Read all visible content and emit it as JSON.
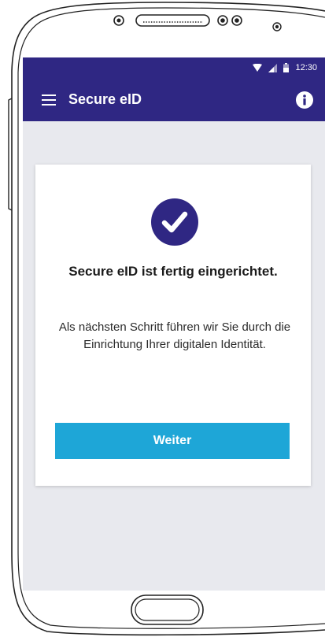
{
  "status_bar": {
    "time": "12:30",
    "icons": [
      "wifi-icon",
      "signal-icon",
      "battery-icon"
    ]
  },
  "app_bar": {
    "title": "Secure eID",
    "menu_icon": "menu-icon",
    "info_icon": "info-icon"
  },
  "card": {
    "icon": "check-circle-icon",
    "title": "Secure eID ist fertig eingerichtet.",
    "body": "Als nächsten Schritt führen wir Sie durch die Einrichtung Ihrer digitalen Identität.",
    "button_label": "Weiter"
  },
  "colors": {
    "primary": "#2f2783",
    "accent": "#1ea6d7",
    "background": "#e8e9ee",
    "card": "#ffffff"
  }
}
